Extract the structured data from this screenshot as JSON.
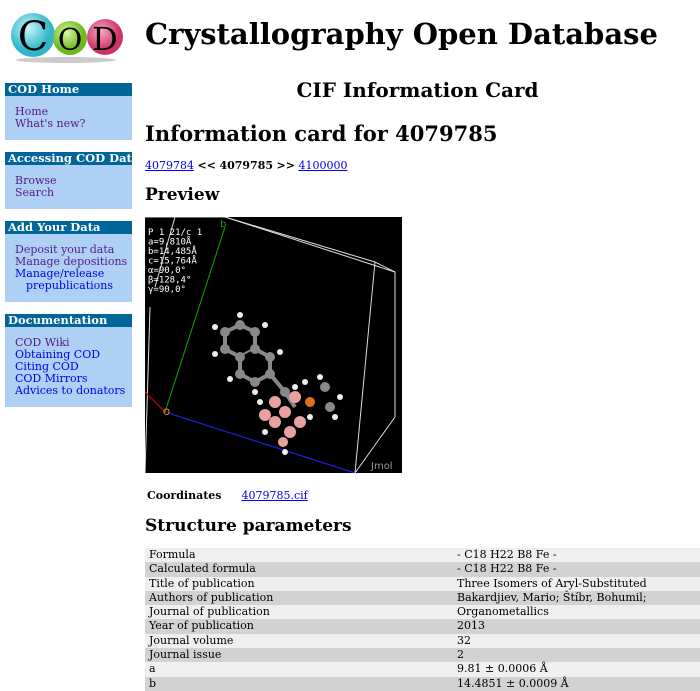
{
  "logo": {
    "text": "COD",
    "colors": [
      "#5bd3df",
      "#8fd43a",
      "#e0507a"
    ]
  },
  "site_title": "Crystallography Open Database",
  "sidebar": [
    {
      "title": "COD Home",
      "items": [
        {
          "label": "Home",
          "visited": true
        },
        {
          "label": "What's new?",
          "visited": true
        }
      ]
    },
    {
      "title": "Accessing COD Data",
      "items": [
        {
          "label": "Browse",
          "visited": true
        },
        {
          "label": "Search",
          "visited": true
        }
      ]
    },
    {
      "title": "Add Your Data",
      "items": [
        {
          "label": "Deposit your data",
          "visited": true
        },
        {
          "label": "Manage depositions",
          "visited": true
        },
        {
          "label": "Manage/release",
          "visited": false
        },
        {
          "label": "prepublications",
          "visited": false
        }
      ]
    },
    {
      "title": "Documentation",
      "items": [
        {
          "label": "COD Wiki",
          "visited": true
        },
        {
          "label": "Obtaining COD",
          "visited": false
        },
        {
          "label": "Citing COD",
          "visited": false
        },
        {
          "label": "COD Mirrors",
          "visited": false
        },
        {
          "label": "Advices to donators",
          "visited": false
        }
      ]
    }
  ],
  "card_title": "CIF Information Card",
  "info_title": "Information card for 4079785",
  "nav": {
    "prev": "4079784",
    "sep1": "<<",
    "current": "4079785",
    "sep2": ">>",
    "next": "4100000"
  },
  "preview_heading": "Preview",
  "jmol": {
    "cell_lines": [
      "P 1 21/c 1",
      "a=9,810Å",
      "b=14,485Å",
      "c=15,764Å",
      "α=90,0°",
      "β=128,4°",
      "γ=90,0°"
    ],
    "axis_b": "b",
    "axis_o": "O",
    "watermark": "Jmol"
  },
  "coordinates": {
    "label": "Coordinates",
    "file": "4079785.cif"
  },
  "structure_heading": "Structure parameters",
  "params": [
    [
      "Formula",
      "- C18 H22 B8 Fe -"
    ],
    [
      "Calculated formula",
      "- C18 H22 B8 Fe -"
    ],
    [
      "Title of publication",
      "Three Isomers of Aryl-Substituted"
    ],
    [
      "Authors of publication",
      "Bakardjiev, Mario; Štíbr, Bohumil;"
    ],
    [
      "Journal of publication",
      "Organometallics"
    ],
    [
      "Year of publication",
      "2013"
    ],
    [
      "Journal volume",
      "32"
    ],
    [
      "Journal issue",
      "2"
    ],
    [
      "a",
      "9.81 ± 0.0006 Å"
    ],
    [
      "b",
      "14.4851 ± 0.0009 Å"
    ]
  ]
}
